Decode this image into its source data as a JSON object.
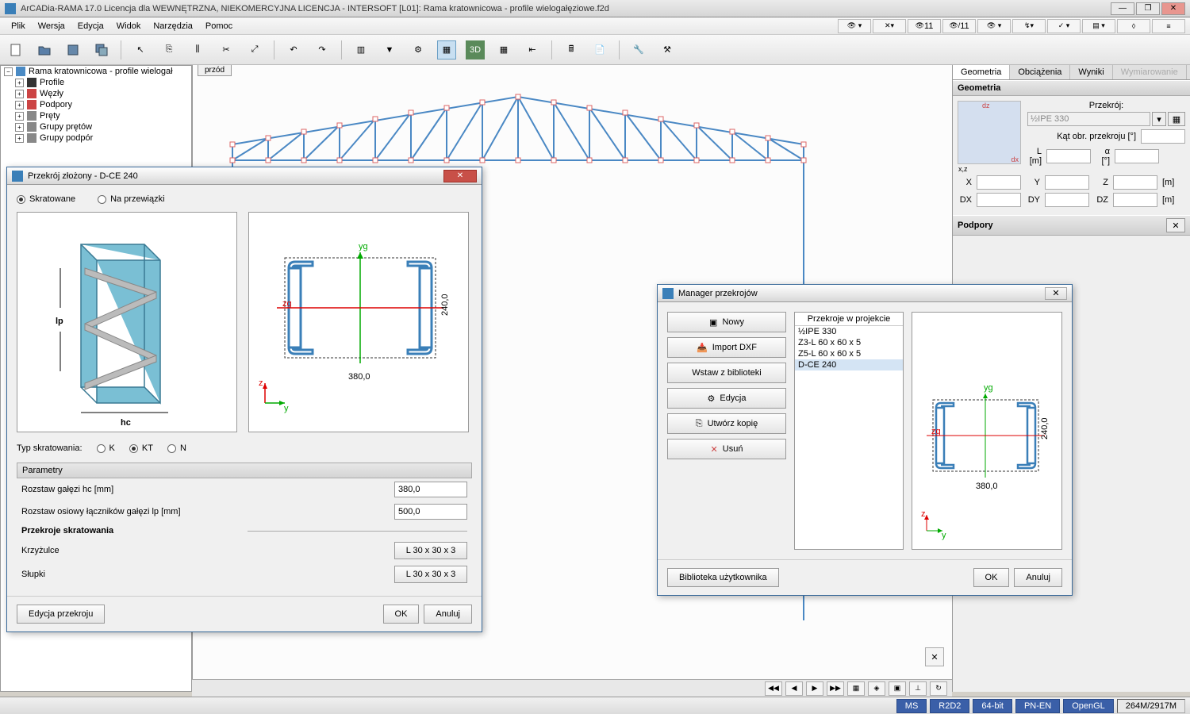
{
  "titlebar": "ArCADia-RAMA 17.0 Licencja dla WEWNĘTRZNA, NIEKOMERCYJNA LICENCJA - INTERSOFT [L01]: Rama kratownicowa - profile wielogałęziowe.f2d",
  "menu": [
    "Plik",
    "Wersja",
    "Edycja",
    "Widok",
    "Narzędzia",
    "Pomoc"
  ],
  "view_tab": "przód",
  "tree": {
    "root": "Rama kratownicowa - profile wielogał",
    "children": [
      "Profile",
      "Węzły",
      "Podpory",
      "Pręty",
      "Grupy prętów",
      "Grupy podpór"
    ]
  },
  "side": {
    "tabs": [
      "Geometria",
      "Obciążenia",
      "Wyniki",
      "Wymiarowanie"
    ],
    "section1": "Geometria",
    "przekroj_label": "Przekrój:",
    "przekroj_value": "½IPE 330",
    "kat_label": "Kąt obr. przekroju [°]",
    "L_label": "L [m]",
    "alpha_label": "α [°]",
    "X": "X",
    "Y": "Y",
    "Z": "Z",
    "m": "[m]",
    "DX": "DX",
    "DY": "DY",
    "DZ": "DZ",
    "dz": "dz",
    "dx": "dx",
    "xz": "x,z",
    "section2": "Podpory"
  },
  "dlg1": {
    "title": "Przekrój złożony - D-CE 240",
    "radio1": "Skratowane",
    "radio2": "Na przewiązki",
    "typ_label": "Typ skratowania:",
    "typ_opts": [
      "K",
      "KT",
      "N"
    ],
    "param_hdr": "Parametry",
    "rows": [
      {
        "label": "Rozstaw gałęzi hc [mm]",
        "value": "380,0"
      },
      {
        "label": "Rozstaw osiowy łączników gałęzi lp [mm]",
        "value": "500,0"
      }
    ],
    "sub_hdr": "Przekroje skratowania",
    "rows2": [
      {
        "label": "Krzyżulce",
        "btn": "L 30 x 30 x 3"
      },
      {
        "label": "Słupki",
        "btn": "L 30 x 30 x 3"
      }
    ],
    "edit_btn": "Edycja przekroju",
    "ok": "OK",
    "cancel": "Anuluj",
    "dims": {
      "width": "380,0",
      "height": "240,0",
      "yg": "yg",
      "zg": "zg",
      "z": "z",
      "y": "y",
      "lp": "lp",
      "hc": "hc"
    }
  },
  "dlg2": {
    "title": "Manager przekrojów",
    "btns": [
      "Nowy",
      "Import DXF",
      "Wstaw z biblioteki",
      "Edycja",
      "Utwórz kopię",
      "Usuń"
    ],
    "list_hdr": "Przekroje w projekcie",
    "items": [
      "½IPE 330",
      "Z3-L 60 x 60 x 5",
      "Z5-L 60 x 60 x 5",
      "D-CE 240"
    ],
    "lib_btn": "Biblioteka użytkownika",
    "ok": "OK",
    "cancel": "Anuluj",
    "dims": {
      "width": "380,0",
      "height": "240,0"
    }
  },
  "status": {
    "cells": [
      "MS",
      "R2D2",
      "64-bit",
      "PN-EN",
      "OpenGL"
    ],
    "mem": "264M/2917M"
  },
  "menubar_nums": {
    "a": "11",
    "b": "11"
  }
}
